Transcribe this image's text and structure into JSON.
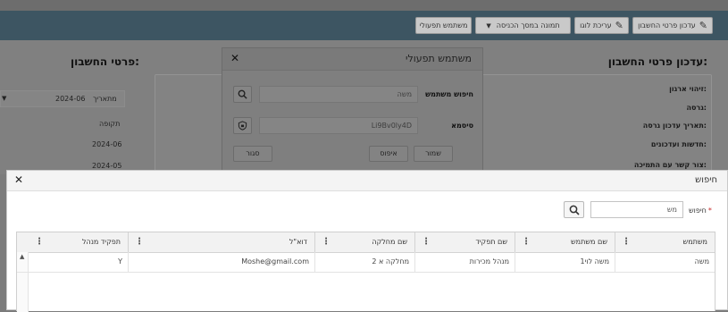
{
  "toolbar": {
    "update_label": "עדכון פרטי החשבון",
    "edit_label": "עריכת לוגו",
    "image_label": "תמונה במסך הכניסה",
    "operative_user_label": "משתמש תפעולי"
  },
  "right_panel": {
    "title": "עדכון פרטי החשבון:",
    "fields": [
      "זיהוי ארגון:",
      "גרסה:",
      "תאריך עדכון גרסה:",
      "חדשות ועדכונים:",
      "צור קשר עם התמיכה:"
    ]
  },
  "left_panel": {
    "title": "פרטי החשבון:",
    "date_label": "מתאריך",
    "date_value": "2024-06",
    "period_label": "תקופה",
    "periods": [
      "2024-06",
      "2024-05"
    ]
  },
  "operative_modal": {
    "title": "משתמש תפעולי",
    "user_search_label": "חיפוש משתמש",
    "user_search_value": "משה",
    "password_label": "סיסמא",
    "password_value": "Li9Bv0ly4D",
    "save_label": "שמור",
    "reset_label": "איפוס",
    "close_label": "סגור"
  },
  "search_dialog": {
    "title": "חיפוש",
    "search_label": "חיפוש",
    "required_mark": "*",
    "search_value": "מש",
    "columns": [
      "משתמש",
      "שם משתמש",
      "שם תפקיד",
      "שם מחלקה",
      "דוא\"ל",
      "תפקיד מנהל"
    ],
    "rows": [
      [
        "משה",
        "משה לוי1",
        "מנהל מכירות",
        "מחלקה א 2",
        "Moshe@gmail.com",
        "Y"
      ]
    ]
  },
  "colors": {
    "nav_band": "#3d5562",
    "required": "#c62828"
  }
}
